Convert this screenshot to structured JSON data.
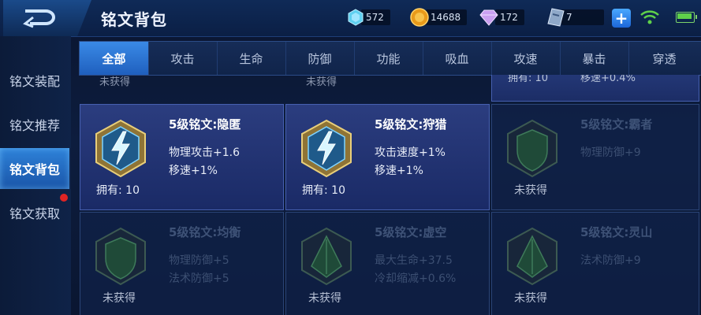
{
  "header": {
    "title": "铭文背包"
  },
  "resources": [
    {
      "icon": "diamond-icon",
      "value": "572"
    },
    {
      "icon": "gold-coin-icon",
      "value": "14688"
    },
    {
      "icon": "purple-crystal-icon",
      "value": "172"
    },
    {
      "icon": "inscription-fragment-icon",
      "value": "7"
    }
  ],
  "sidebar": {
    "items": [
      {
        "label": "铭文装配"
      },
      {
        "label": "铭文推荐"
      },
      {
        "label": "铭文背包"
      },
      {
        "label": "铭文获取"
      }
    ]
  },
  "tabs": [
    {
      "label": "全部"
    },
    {
      "label": "攻击"
    },
    {
      "label": "生命"
    },
    {
      "label": "防御"
    },
    {
      "label": "功能"
    },
    {
      "label": "吸血"
    },
    {
      "label": "攻速"
    },
    {
      "label": "暴击"
    },
    {
      "label": "穿透"
    }
  ],
  "partial_row": {
    "col1": "未获得",
    "col2": "未获得",
    "col3_owned": "拥有: 10",
    "col3_attr": "移速+0.4%"
  },
  "cards": [
    {
      "name": "5级铭文:隐匿",
      "attrs": [
        "物理攻击+1.6",
        "移速+1%"
      ],
      "status": "拥有: 10",
      "owned": true,
      "color": "#9fd8ff"
    },
    {
      "name": "5级铭文:狩猎",
      "attrs": [
        "攻击速度+1%",
        "移速+1%"
      ],
      "status": "拥有: 10",
      "owned": true,
      "color": "#9fd8ff"
    },
    {
      "name": "5级铭文:霸者",
      "attrs": [
        "物理防御+9"
      ],
      "status": "未获得",
      "owned": false,
      "color": "#2f6a4a"
    },
    {
      "name": "5级铭文:均衡",
      "attrs": [
        "物理防御+5",
        "法术防御+5"
      ],
      "status": "未获得",
      "owned": false,
      "color": "#2f6a4a"
    },
    {
      "name": "5级铭文:虚空",
      "attrs": [
        "最大生命+37.5",
        "冷却缩减+0.6%"
      ],
      "status": "未获得",
      "owned": false,
      "color": "#2f6a4a"
    },
    {
      "name": "5级铭文:灵山",
      "attrs": [
        "法术防御+9"
      ],
      "status": "未获得",
      "owned": false,
      "color": "#2f6a4a"
    }
  ]
}
